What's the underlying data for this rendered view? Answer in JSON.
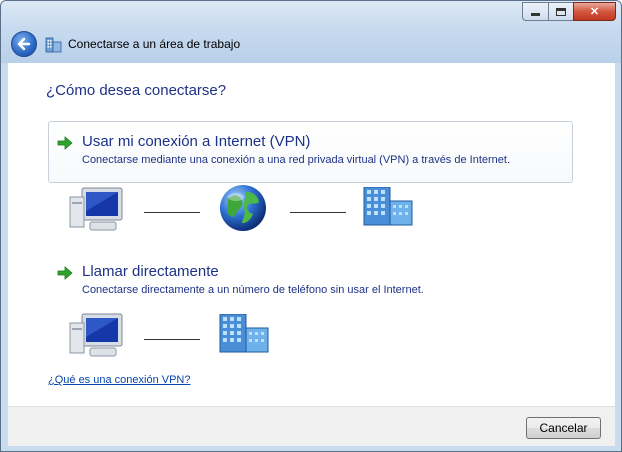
{
  "window": {
    "title": "Conectarse a un área de trabajo",
    "caption_buttons": {
      "minimize": "minimize-icon",
      "maximize": "maximize-icon",
      "close": "close-icon"
    }
  },
  "main": {
    "question": "¿Cómo desea conectarse?",
    "options": [
      {
        "title": "Usar mi conexión a Internet (VPN)",
        "description": "Conectarse mediante una conexión a una red privada virtual (VPN) a través de Internet.",
        "selected": true,
        "icon": "green-arrow-icon",
        "diagram": [
          "computer-icon",
          "globe-icon",
          "building-icon"
        ]
      },
      {
        "title": "Llamar directamente",
        "description": "Conectarse directamente a un número de teléfono sin usar el Internet.",
        "selected": false,
        "icon": "green-arrow-icon",
        "diagram": [
          "computer-icon",
          "building-icon"
        ]
      }
    ],
    "help_link": "¿Qué es una conexión VPN?"
  },
  "footer": {
    "cancel_label": "Cancelar"
  },
  "colors": {
    "heading_blue": "#1e3287",
    "link_blue": "#0645ad",
    "accent_green": "#2fa52f"
  }
}
